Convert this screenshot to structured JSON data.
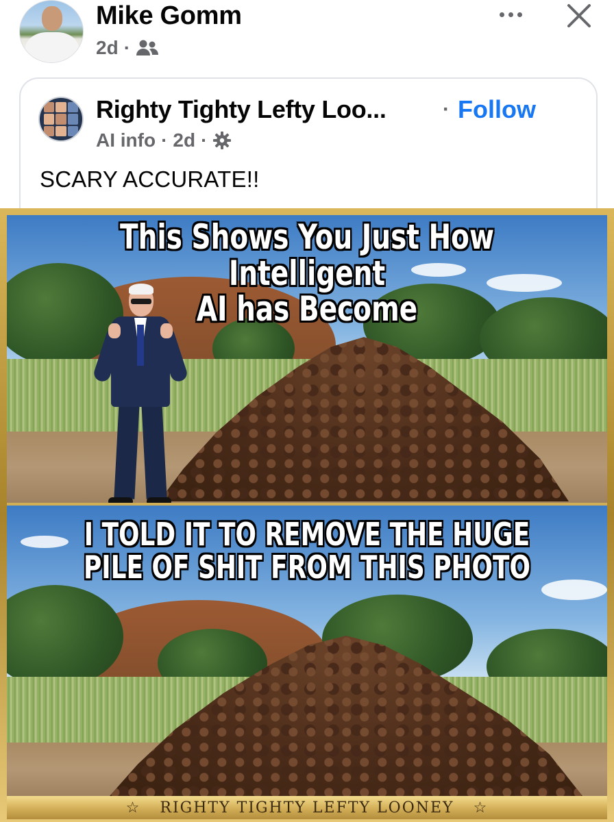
{
  "post": {
    "author_name": "Mike Gomm",
    "time": "2d",
    "separator": "·",
    "audience_icon": "friends-icon",
    "more_icon": "more-horizontal-icon",
    "close_icon": "close-icon"
  },
  "shared": {
    "page_name": "Righty Tighty Lefty Loo...",
    "separator": "·",
    "follow_label": "Follow",
    "ai_info_label": "AI info",
    "time": "2d",
    "settings_icon": "gear-icon",
    "caption": "SCARY ACCURATE!!"
  },
  "meme": {
    "top_text_line1": "This Shows You Just How Intelligent",
    "top_text_line2": "AI has Become",
    "bottom_text_line1": "I TOLD IT TO REMOVE THE HUGE",
    "bottom_text_line2": "PILE OF SHIT FROM THIS PHOTO",
    "banner_text": "RIGHTY TIGHTY LEFTY LOONEY",
    "banner_star": "☆"
  },
  "colors": {
    "link_blue": "#1877f2",
    "meta_gray": "#65676b",
    "gold_frame": "#cfae55"
  }
}
